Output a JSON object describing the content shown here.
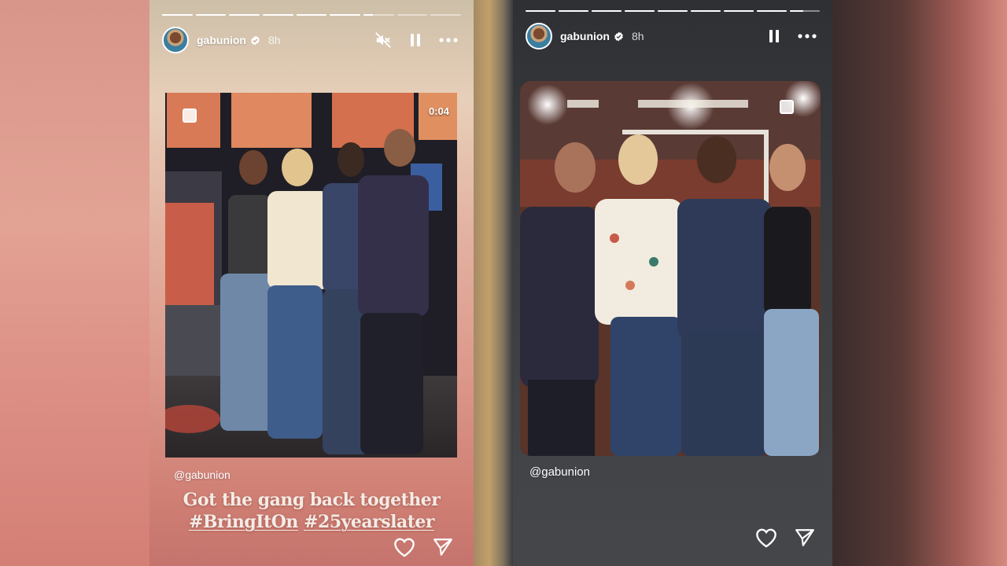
{
  "colors": {
    "left_story_top": "#e8cfb9",
    "left_story_bottom": "#c4746d",
    "right_story_bg": "#3a3c40",
    "text": "#ffffff"
  },
  "stories": [
    {
      "username": "gabunion",
      "verified": true,
      "timestamp": "8h",
      "progress": {
        "segments": 9,
        "current_segment": 6,
        "current_fill_fraction": 0.3
      },
      "controls": [
        "muted-icon",
        "pause-icon",
        "more-icon"
      ],
      "media_type": "video",
      "duration": "0:04",
      "mention": "@gabunion",
      "caption": {
        "line1": "Got the gang back together",
        "hashtag1": "#BringItOn",
        "hashtag2": "#25yearslater"
      },
      "actions": [
        "heart-icon",
        "send-icon"
      ]
    },
    {
      "username": "gabunion",
      "verified": true,
      "timestamp": "8h",
      "progress": {
        "segments": 9,
        "current_segment": 8,
        "current_fill_fraction": 0.45
      },
      "controls": [
        "pause-icon",
        "more-icon"
      ],
      "media_type": "photo",
      "mention": "@gabunion",
      "actions": [
        "heart-icon",
        "send-icon"
      ]
    }
  ]
}
